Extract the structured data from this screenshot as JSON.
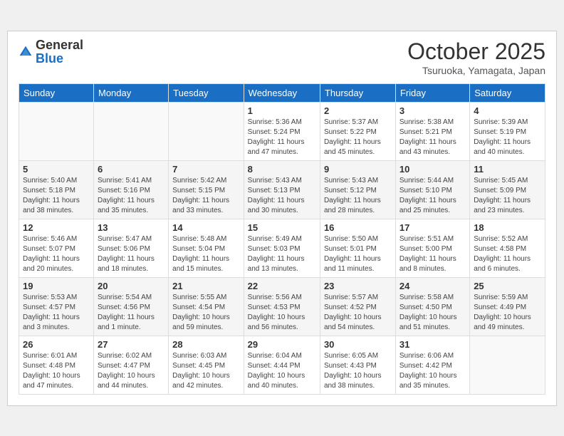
{
  "header": {
    "logo_general": "General",
    "logo_blue": "Blue",
    "month": "October 2025",
    "location": "Tsuruoka, Yamagata, Japan"
  },
  "days_of_week": [
    "Sunday",
    "Monday",
    "Tuesday",
    "Wednesday",
    "Thursday",
    "Friday",
    "Saturday"
  ],
  "weeks": [
    [
      {
        "day": "",
        "content": ""
      },
      {
        "day": "",
        "content": ""
      },
      {
        "day": "",
        "content": ""
      },
      {
        "day": "1",
        "content": "Sunrise: 5:36 AM\nSunset: 5:24 PM\nDaylight: 11 hours\nand 47 minutes."
      },
      {
        "day": "2",
        "content": "Sunrise: 5:37 AM\nSunset: 5:22 PM\nDaylight: 11 hours\nand 45 minutes."
      },
      {
        "day": "3",
        "content": "Sunrise: 5:38 AM\nSunset: 5:21 PM\nDaylight: 11 hours\nand 43 minutes."
      },
      {
        "day": "4",
        "content": "Sunrise: 5:39 AM\nSunset: 5:19 PM\nDaylight: 11 hours\nand 40 minutes."
      }
    ],
    [
      {
        "day": "5",
        "content": "Sunrise: 5:40 AM\nSunset: 5:18 PM\nDaylight: 11 hours\nand 38 minutes."
      },
      {
        "day": "6",
        "content": "Sunrise: 5:41 AM\nSunset: 5:16 PM\nDaylight: 11 hours\nand 35 minutes."
      },
      {
        "day": "7",
        "content": "Sunrise: 5:42 AM\nSunset: 5:15 PM\nDaylight: 11 hours\nand 33 minutes."
      },
      {
        "day": "8",
        "content": "Sunrise: 5:43 AM\nSunset: 5:13 PM\nDaylight: 11 hours\nand 30 minutes."
      },
      {
        "day": "9",
        "content": "Sunrise: 5:43 AM\nSunset: 5:12 PM\nDaylight: 11 hours\nand 28 minutes."
      },
      {
        "day": "10",
        "content": "Sunrise: 5:44 AM\nSunset: 5:10 PM\nDaylight: 11 hours\nand 25 minutes."
      },
      {
        "day": "11",
        "content": "Sunrise: 5:45 AM\nSunset: 5:09 PM\nDaylight: 11 hours\nand 23 minutes."
      }
    ],
    [
      {
        "day": "12",
        "content": "Sunrise: 5:46 AM\nSunset: 5:07 PM\nDaylight: 11 hours\nand 20 minutes."
      },
      {
        "day": "13",
        "content": "Sunrise: 5:47 AM\nSunset: 5:06 PM\nDaylight: 11 hours\nand 18 minutes."
      },
      {
        "day": "14",
        "content": "Sunrise: 5:48 AM\nSunset: 5:04 PM\nDaylight: 11 hours\nand 15 minutes."
      },
      {
        "day": "15",
        "content": "Sunrise: 5:49 AM\nSunset: 5:03 PM\nDaylight: 11 hours\nand 13 minutes."
      },
      {
        "day": "16",
        "content": "Sunrise: 5:50 AM\nSunset: 5:01 PM\nDaylight: 11 hours\nand 11 minutes."
      },
      {
        "day": "17",
        "content": "Sunrise: 5:51 AM\nSunset: 5:00 PM\nDaylight: 11 hours\nand 8 minutes."
      },
      {
        "day": "18",
        "content": "Sunrise: 5:52 AM\nSunset: 4:58 PM\nDaylight: 11 hours\nand 6 minutes."
      }
    ],
    [
      {
        "day": "19",
        "content": "Sunrise: 5:53 AM\nSunset: 4:57 PM\nDaylight: 11 hours\nand 3 minutes."
      },
      {
        "day": "20",
        "content": "Sunrise: 5:54 AM\nSunset: 4:56 PM\nDaylight: 11 hours\nand 1 minute."
      },
      {
        "day": "21",
        "content": "Sunrise: 5:55 AM\nSunset: 4:54 PM\nDaylight: 10 hours\nand 59 minutes."
      },
      {
        "day": "22",
        "content": "Sunrise: 5:56 AM\nSunset: 4:53 PM\nDaylight: 10 hours\nand 56 minutes."
      },
      {
        "day": "23",
        "content": "Sunrise: 5:57 AM\nSunset: 4:52 PM\nDaylight: 10 hours\nand 54 minutes."
      },
      {
        "day": "24",
        "content": "Sunrise: 5:58 AM\nSunset: 4:50 PM\nDaylight: 10 hours\nand 51 minutes."
      },
      {
        "day": "25",
        "content": "Sunrise: 5:59 AM\nSunset: 4:49 PM\nDaylight: 10 hours\nand 49 minutes."
      }
    ],
    [
      {
        "day": "26",
        "content": "Sunrise: 6:01 AM\nSunset: 4:48 PM\nDaylight: 10 hours\nand 47 minutes."
      },
      {
        "day": "27",
        "content": "Sunrise: 6:02 AM\nSunset: 4:47 PM\nDaylight: 10 hours\nand 44 minutes."
      },
      {
        "day": "28",
        "content": "Sunrise: 6:03 AM\nSunset: 4:45 PM\nDaylight: 10 hours\nand 42 minutes."
      },
      {
        "day": "29",
        "content": "Sunrise: 6:04 AM\nSunset: 4:44 PM\nDaylight: 10 hours\nand 40 minutes."
      },
      {
        "day": "30",
        "content": "Sunrise: 6:05 AM\nSunset: 4:43 PM\nDaylight: 10 hours\nand 38 minutes."
      },
      {
        "day": "31",
        "content": "Sunrise: 6:06 AM\nSunset: 4:42 PM\nDaylight: 10 hours\nand 35 minutes."
      },
      {
        "day": "",
        "content": ""
      }
    ]
  ]
}
